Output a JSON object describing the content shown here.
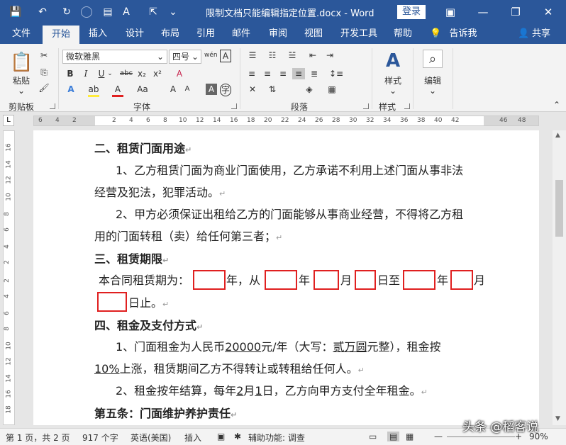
{
  "titlebar": {
    "doc_title": "限制文档只能编辑指定位置.docx  -  Word",
    "login": "登录",
    "qa_save": "💾",
    "qa_undo": "↶",
    "qa_redo": "↻",
    "qa_more": "⌄",
    "minimize": "—",
    "restore": "❐",
    "close": "✕",
    "ribbon_opts": "▣"
  },
  "tabs": [
    "文件",
    "开始",
    "插入",
    "设计",
    "布局",
    "引用",
    "邮件",
    "审阅",
    "视图",
    "开发工具",
    "帮助",
    "告诉我",
    "共享"
  ],
  "ribbon": {
    "clipboard_label": "剪贴板",
    "paste": "粘贴",
    "font_label": "字体",
    "font_name": "微软雅黑",
    "font_size": "四号",
    "para_label": "段落",
    "style_label": "样式",
    "styles": "样式",
    "edit": "编辑"
  },
  "ruler": [
    "6",
    "4",
    "2",
    "2",
    "4",
    "6",
    "8",
    "10",
    "12",
    "14",
    "16",
    "18",
    "20",
    "22",
    "24",
    "26",
    "28",
    "30",
    "32",
    "34",
    "36",
    "38",
    "40",
    "42",
    "46",
    "48"
  ],
  "vruler": [
    "16",
    "14",
    "12",
    "10",
    "8",
    "6",
    "4",
    "2",
    "2",
    "4",
    "6",
    "8",
    "10",
    "12",
    "14",
    "16",
    "18",
    "20"
  ],
  "doc": {
    "h2": "二、租赁门面用途",
    "p1a": "1、乙方租赁门面为商业门面使用，乙方承诺不利用上述门面从事非法",
    "p1b": "经营及犯法，犯罪活动。",
    "p2a": "2、甲方必须保证出租给乙方的门面能够从事商业经营，不得将乙方租",
    "p2b": "用的门面转租（卖）给任何第三者；",
    "h3": "三、租赁期限",
    "t_pre": "本合同租赁期为：",
    "t_year": "年，从",
    "t_y2": "年",
    "t_m1": "月",
    "t_d1": "日至",
    "t_y3": "年",
    "t_m2": "月",
    "t_end": "日止。",
    "h4": "四、租金及支付方式",
    "p3a_1": "1、门面租金为人民币",
    "p3a_amt": "20000",
    "p3a_2": "元/年（大写：",
    "p3a_cn": "贰万圆",
    "p3a_3": "元整），租金按",
    "p3b_pct": "10%",
    "p3b_rest": "上涨，租赁期间乙方不得转让或转租给任何人。",
    "p4_1": "2、租金按年结算，每年",
    "p4_m": "2",
    "p4_2": "月",
    "p4_d": "1",
    "p4_3": "日，乙方向甲方支付全年租金。",
    "h5": "第五条：门面维护养护责任"
  },
  "status": {
    "page": "第 1 页，共 2 页",
    "words": "917 个字",
    "lang": "英语(美国)",
    "mode": "插入",
    "access": "辅助功能: 调查",
    "zoom": "90%"
  },
  "watermark": "头条 @稻客说"
}
